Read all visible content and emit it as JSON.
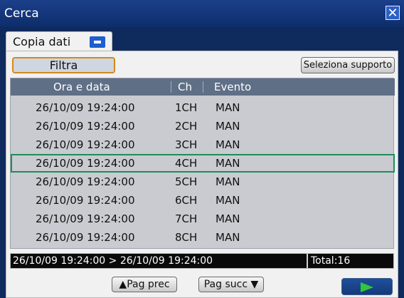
{
  "window": {
    "title": "Cerca",
    "close_glyph": "✕"
  },
  "tabs": [
    {
      "label": "Copia dati",
      "icon": "sd-card-icon"
    }
  ],
  "toolbar": {
    "filter_label": "Filtra",
    "media_label": "Seleziona supporto"
  },
  "table": {
    "columns": [
      "Ora e data",
      "Ch",
      "Evento"
    ],
    "rows": [
      {
        "datetime": "26/10/09 19:24:00",
        "ch": "1CH",
        "event": "MAN"
      },
      {
        "datetime": "26/10/09 19:24:00",
        "ch": "2CH",
        "event": "MAN"
      },
      {
        "datetime": "26/10/09 19:24:00",
        "ch": "3CH",
        "event": "MAN"
      },
      {
        "datetime": "26/10/09 19:24:00",
        "ch": "4CH",
        "event": "MAN"
      },
      {
        "datetime": "26/10/09 19:24:00",
        "ch": "5CH",
        "event": "MAN"
      },
      {
        "datetime": "26/10/09 19:24:00",
        "ch": "6CH",
        "event": "MAN"
      },
      {
        "datetime": "26/10/09 19:24:00",
        "ch": "7CH",
        "event": "MAN"
      },
      {
        "datetime": "26/10/09 19:24:00",
        "ch": "8CH",
        "event": "MAN"
      }
    ],
    "selected_index": 3
  },
  "status": {
    "range": "26/10/09 19:24:00 > 26/10/09 19:24:00",
    "total": "Total:16"
  },
  "pager": {
    "prev_label": "▲Pag prec",
    "next_label": "Pag succ ▼"
  },
  "colors": {
    "title_bar": "#1c3f8a",
    "filter_border": "#d48a1a",
    "selection": "#1e8e5a",
    "play": "#31c73a"
  }
}
